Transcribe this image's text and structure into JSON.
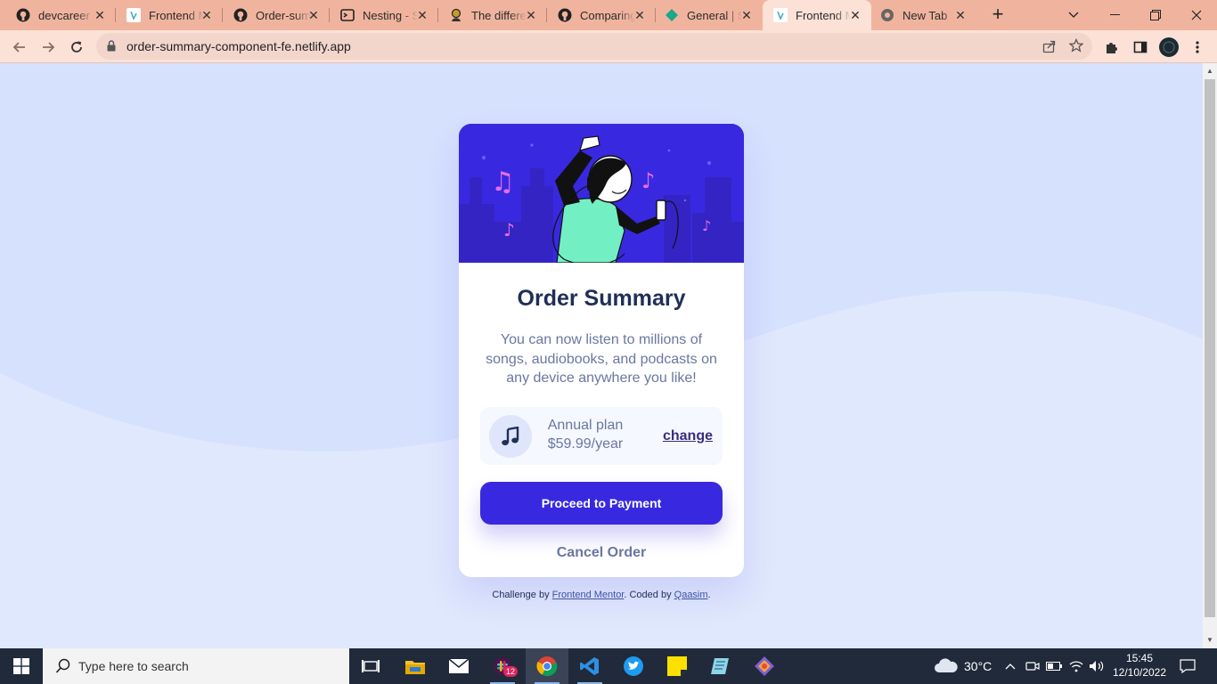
{
  "browser": {
    "tabs": [
      {
        "label": "devcareer",
        "icon": "github-icon"
      },
      {
        "label": "Frontend M",
        "icon": "frontend-mentor-icon"
      },
      {
        "label": "Order-sum",
        "icon": "github-icon"
      },
      {
        "label": "Nesting - S",
        "icon": "terminal-icon"
      },
      {
        "label": "The differe",
        "icon": "person-icon"
      },
      {
        "label": "Comparing",
        "icon": "github-icon"
      },
      {
        "label": "General | S",
        "icon": "diamond-icon"
      },
      {
        "label": "Frontend M",
        "icon": "frontend-mentor-icon",
        "active": true
      },
      {
        "label": "New Tab",
        "icon": "chrome-icon"
      }
    ],
    "url": "order-summary-component-fe.netlify.app"
  },
  "card": {
    "title": "Order Summary",
    "description": "You can now listen to millions of songs, audiobooks, and podcasts on any device anywhere you like!",
    "plan_name": "Annual plan",
    "plan_price": "$59.99/year",
    "change_label": "change",
    "pay_label": "Proceed to Payment",
    "cancel_label": "Cancel Order"
  },
  "attribution": {
    "prefix": "Challenge by",
    "link1": "Frontend Mentor",
    "middle": ". Coded by",
    "link2": "Qaasim",
    "suffix": "."
  },
  "taskbar": {
    "search_placeholder": "Type here to search",
    "slack_badge": "12",
    "weather": "30°C",
    "time": "15:45",
    "date": "12/10/2022"
  },
  "colors": {
    "tabbar": "#f0b49e",
    "toolbar": "#fbe1d6",
    "page_bg": "#d6e1fe",
    "primary": "#3829e0",
    "title": "#1f2f56",
    "text_muted": "#6a77a0"
  }
}
